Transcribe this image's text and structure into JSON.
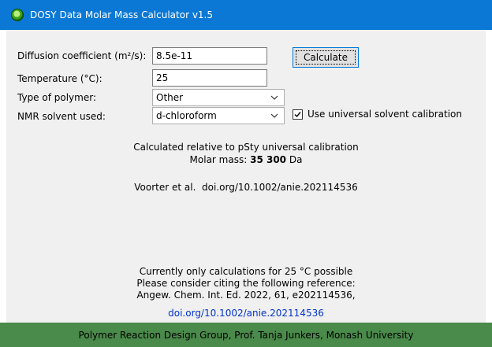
{
  "window": {
    "title": "DOSY Data Molar Mass Calculator v1.5",
    "icon": "green-circle-app-icon"
  },
  "form": {
    "diffusion": {
      "label": "Diffusion coefficient (m²/s):",
      "value": "8.5e-11"
    },
    "temperature": {
      "label": "Temperature (°C):",
      "value": "25"
    },
    "polymer": {
      "label": "Type of polymer:",
      "selected": "Other"
    },
    "solvent": {
      "label": "NMR solvent used:",
      "selected": "d-chloroform"
    },
    "calculate_label": "Calculate",
    "universal_calibration": {
      "label": "Use universal solvent calibration",
      "checked": true
    }
  },
  "result": {
    "line1": "Calculated relative to pSty universal calibration",
    "molar_mass_prefix": "Molar mass: ",
    "molar_mass_value": "35 300",
    "molar_mass_unit": " Da",
    "reference": "Voorter et al.  doi.org/10.1002/anie.202114536"
  },
  "notice": {
    "line1": "Currently only calculations for 25 °C possible",
    "line2": "Please consider citing the following reference:",
    "line3": "Angew. Chem. Int. Ed. 2022, 61, e202114536,",
    "link": "doi.org/10.1002/anie.202114536"
  },
  "footer": {
    "text": "Polymer Reaction Design Group, Prof. Tanja Junkers, Monash University"
  },
  "colors": {
    "titlebar": "#0a78d4",
    "body": "#f0f0f0",
    "footer": "#4a8a4a",
    "link": "#0033cc"
  }
}
